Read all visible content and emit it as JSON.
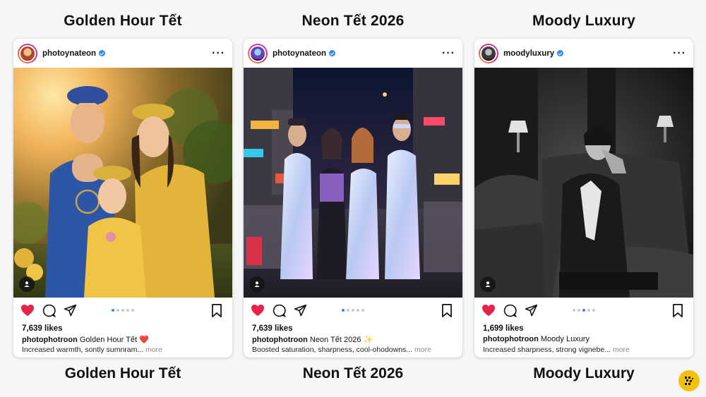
{
  "columns": [
    {
      "title": "Golden Hour Tết",
      "bottom_title": "Golden Hour Tết",
      "post": {
        "username": "photoynateon",
        "likes": "7,639 likes",
        "caption_user": "photophotroon",
        "caption_text": "Golden Hour Tết ❤️",
        "description": "Increased warmth, sontly sumnram...",
        "more": "more",
        "carousel_active_index": 0,
        "liked": true
      }
    },
    {
      "title": "Neon Tết 2026",
      "bottom_title": "Neon Tết 2026",
      "post": {
        "username": "photoynateon",
        "likes": "7,639 likes",
        "caption_user": "photophotroon",
        "caption_text": "Neon Tết 2026 ✨",
        "description": "Boosted saturation, sharpness, cool-ohodowns...",
        "more": "more",
        "carousel_active_index": 0,
        "liked": true
      }
    },
    {
      "title": "Moody Luxury",
      "bottom_title": "Moody Luxury",
      "post": {
        "username": "moodyluxury",
        "likes": "1,699 likes",
        "caption_user": "photophotroon",
        "caption_text": "Moody Luxury",
        "description": "Increased sharpness, strong vignebe...",
        "more": "more",
        "carousel_active_index": 2,
        "liked": true
      }
    }
  ],
  "icons": {
    "more": "more-options-icon",
    "like": "heart-icon",
    "comment": "comment-icon",
    "share": "share-icon",
    "save": "bookmark-icon",
    "tag": "user-tag-icon",
    "verified": "verified-badge-icon",
    "logo": "logo-badge"
  },
  "colors": {
    "like": "#e8234a",
    "verified": "#2f8bf0",
    "logo": "#f4c20d"
  }
}
